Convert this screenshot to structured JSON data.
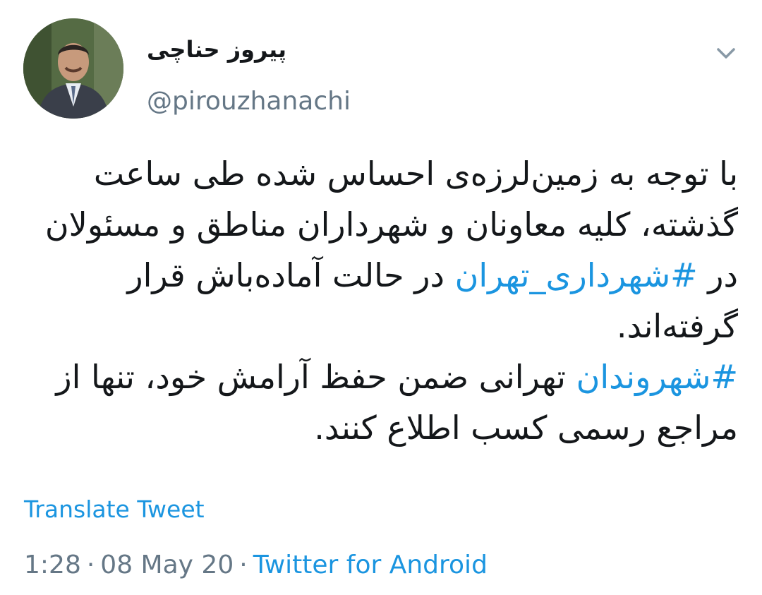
{
  "author": {
    "display_name": "پیروز حناچی",
    "handle": "@pirouzhanachi",
    "avatar_icon": "profile-photo"
  },
  "menu_icon": "chevron-down-icon",
  "tweet": {
    "paragraph1": {
      "before": "با توجه به زمین‌لرزه‌ی احساس شده طی ساعت گذشته، کلیه معاونان و شهرداران مناطق و مسئولان در ",
      "hashtag": "#شهرداری_تهران",
      "after": " در حالت آماده‌باش قرار گرفته‌اند."
    },
    "paragraph2": {
      "hashtag": "#شهروندان",
      "after": " تهرانی ضمن حفظ آرامش خود، تنها از مراجع رسمی کسب اطلاع کنند."
    }
  },
  "translate_label": "Translate Tweet",
  "meta": {
    "time": "1:28",
    "separator": "·",
    "date": "08 May 20",
    "source": "Twitter for Android"
  },
  "colors": {
    "link": "#1b95e0",
    "secondary": "#657786",
    "text": "#14171a"
  }
}
